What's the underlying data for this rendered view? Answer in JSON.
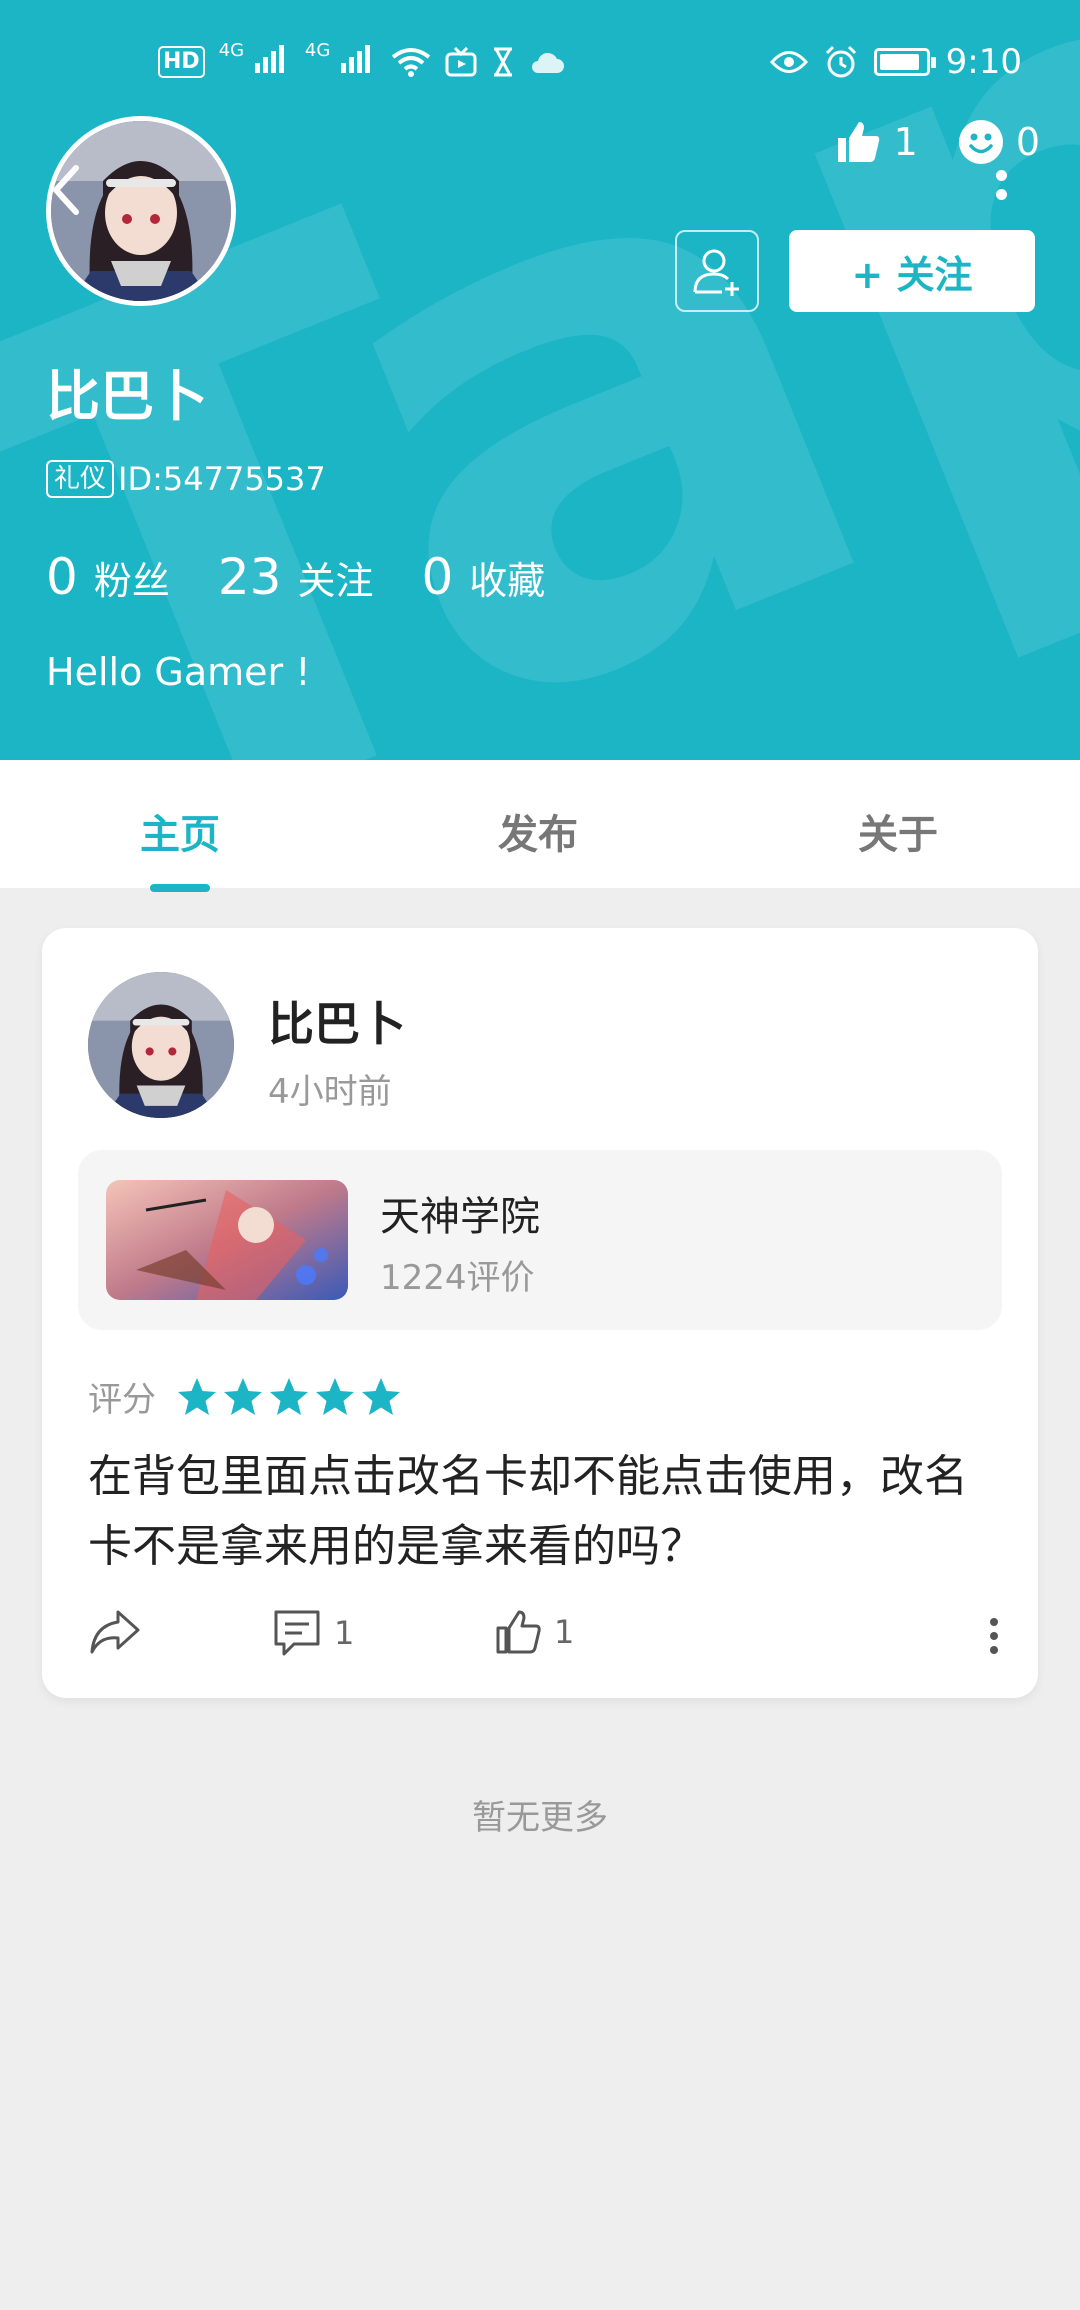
{
  "status_bar": {
    "hd_label": "HD",
    "sim1": "4G",
    "sim2": "4G",
    "time": "9:10",
    "battery_level": 0.9
  },
  "profile": {
    "username": "比巴卜",
    "tag": "礼仪",
    "id_text": "ID:54775537",
    "likes_count": "1",
    "smiles_count": "0",
    "follow_button": "+ 关注",
    "stats": [
      {
        "num": "0",
        "label": "粉丝"
      },
      {
        "num": "23",
        "label": "关注"
      },
      {
        "num": "0",
        "label": "收藏"
      }
    ],
    "bio": "Hello Gamer !"
  },
  "tabs": [
    {
      "label": "主页",
      "active": true
    },
    {
      "label": "发布",
      "active": false
    },
    {
      "label": "关于",
      "active": false
    }
  ],
  "post": {
    "author": "比巴卜",
    "time": "4小时前",
    "game": {
      "name": "天神学院",
      "reviews": "1224评价"
    },
    "rating_label": "评分",
    "rating_stars": 5,
    "text": "在背包里面点击改名卡却不能点击使用，改名卡不是拿来用的是拿来看的吗？",
    "comment_count": "1",
    "like_count": "1"
  },
  "footer_text": "暂无更多",
  "colors": {
    "accent": "#1bb5c6",
    "background": "#eeeeee"
  }
}
